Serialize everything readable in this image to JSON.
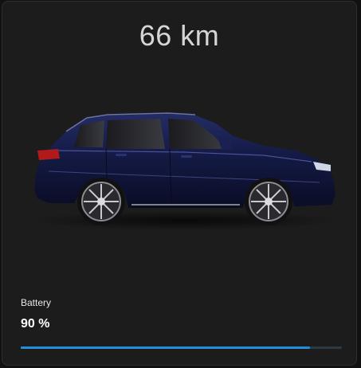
{
  "range": {
    "text": "66 km"
  },
  "vehicle": {
    "icon": "car-image",
    "body_color": "#141a44"
  },
  "battery": {
    "label": "Battery",
    "value_text": "90 %",
    "level": 0.9,
    "bar_color": "#1e8fd8",
    "track_color": "#2b3a44"
  }
}
